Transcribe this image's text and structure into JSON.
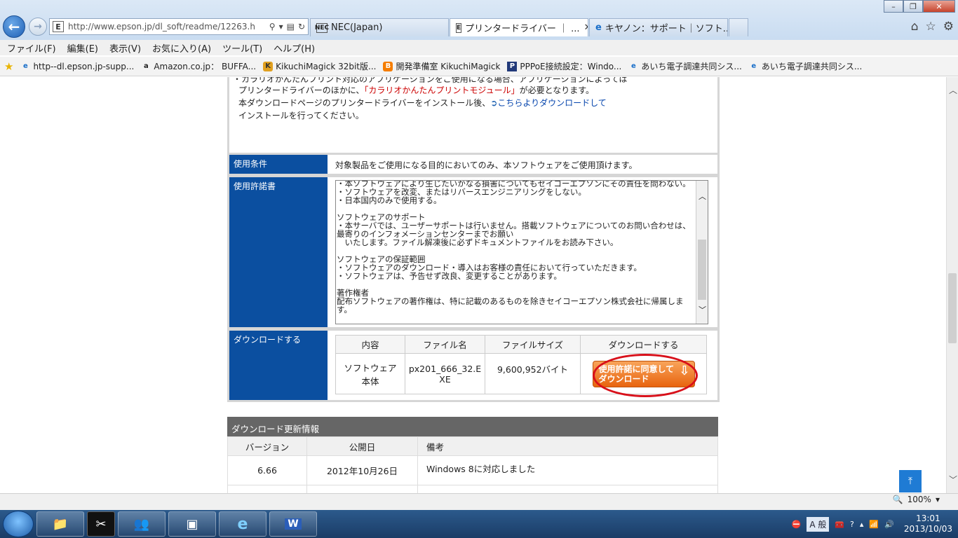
{
  "browser": {
    "address": "http://www.epson.jp/dl_soft/readme/12263.h",
    "tabs": [
      {
        "icon": "NEC",
        "label": "NEC(Japan)"
      },
      {
        "icon": "E",
        "label": "プリンタードライバー ｜ ..."
      },
      {
        "icon": "e",
        "label": "キヤノン：サポート｜ソフト..."
      }
    ],
    "menu": [
      "ファイル(F)",
      "編集(E)",
      "表示(V)",
      "お気に入り(A)",
      "ツール(T)",
      "ヘルプ(H)"
    ],
    "favorites": [
      {
        "icon": "e",
        "label": "http--dl.epson.jp-supp..."
      },
      {
        "icon": "a",
        "label": "Amazon.co.jp： BUFFA..."
      },
      {
        "icon": "K",
        "label": "KikuchiMagick 32bit版..."
      },
      {
        "icon": "B",
        "label": "開発準備室 KikuchiMagick"
      },
      {
        "icon": "P",
        "label": "PPPoE接続設定：Windo..."
      },
      {
        "icon": "e",
        "label": "あいち電子調達共同シス..."
      },
      {
        "icon": "e",
        "label": "あいち電子調達共同シス..."
      }
    ]
  },
  "page": {
    "note_lines": [
      "・カラリオかんたんプリント対応のアプリケーションをご使用になる場合、アプリケーションによっては",
      "プリンタードライバーのほかに、",
      "「カラリオかんたんプリントモジュール」",
      "が必要となります。",
      "本ダウンロードページのプリンタードライバーをインストール後、",
      "こちらよりダウンロードして",
      "インストールを行ってください。"
    ],
    "conditions_label": "使用条件",
    "conditions_text": "対象製品をご使用になる目的においてのみ、本ソフトウェアをご使用頂けます。",
    "license_label": "使用許諾書",
    "license_text": "・本ソフトウェアにより生じたいかなる損害についてもセイコーエプソンにその責任を問わない。\n・ソフトウェアを改変、またはリバースエンジニアリングをしない。\n・日本国内のみで使用する。\n\nソフトウェアのサポート\n・本サーバでは、ユーザーサポートは行いません。搭載ソフトウェアについてのお問い合わせは、最寄りのインフォメーションセンターまでお願い\n　いたします。ファイル解凍後に必ずドキュメントファイルをお読み下さい。\n\nソフトウェアの保証範囲\n・ソフトウェアのダウンロード・導入はお客様の責任において行っていただきます。\n・ソフトウェアは、予告せず改良、変更することがあります。\n\n著作権者\n配布ソフトウェアの著作権は、特に記載のあるものを除きセイコーエプソン株式会社に帰属します。",
    "download_label": "ダウンロードする",
    "download_table": {
      "headers": [
        "内容",
        "ファイル名",
        "ファイルサイズ",
        "ダウンロードする"
      ],
      "row": {
        "content": "ソフトウェア本体",
        "filename": "px201_666_32.EXE",
        "size": "9,600,952バイト",
        "button": "使用許諾に同意してダウンロード"
      }
    },
    "updates_title": "ダウンロード更新情報",
    "updates_headers": [
      "バージョン",
      "公開日",
      "備考"
    ],
    "updates_rows": [
      {
        "version": "6.66",
        "date": "2012年10月26日",
        "note": "Windows 8に対応しました"
      }
    ]
  },
  "statusbar": {
    "zoom": "100%"
  },
  "taskbar": {
    "ime": "A 般",
    "time": "13:01",
    "date": "2013/10/03"
  }
}
